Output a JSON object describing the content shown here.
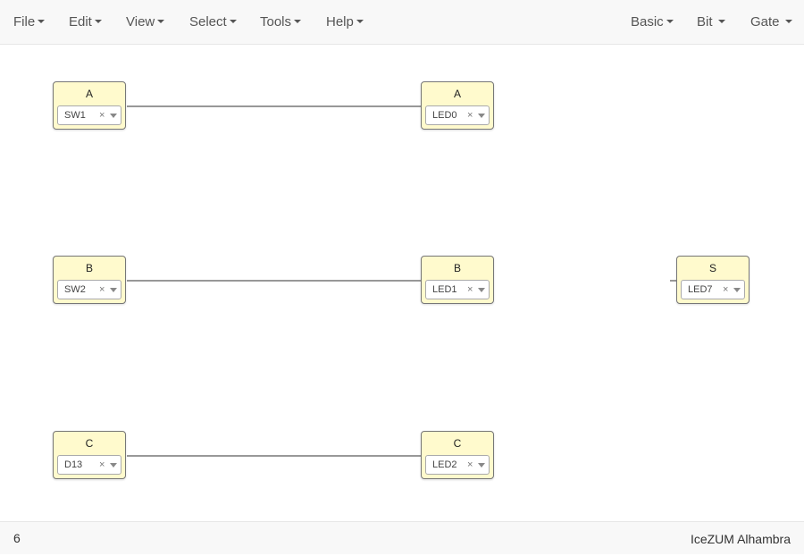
{
  "menus_left": [
    "File",
    "Edit",
    "View",
    "Select",
    "Tools",
    "Help"
  ],
  "menus_right": [
    "Basic",
    "Bit",
    "Gate"
  ],
  "blocks": {
    "in_a": {
      "label": "A",
      "pin": "SW1"
    },
    "in_b": {
      "label": "B",
      "pin": "SW2"
    },
    "in_c": {
      "label": "C",
      "pin": "D13"
    },
    "out_a": {
      "label": "A",
      "pin": "LED0"
    },
    "out_b": {
      "label": "B",
      "pin": "LED1"
    },
    "out_c": {
      "label": "C",
      "pin": "LED2"
    },
    "out_s": {
      "label": "S",
      "pin": "LED7"
    }
  },
  "pin_clear_glyph": "×",
  "colors": {
    "block_fill": "#fffacd",
    "block_border": "#777777",
    "wire": "#777777",
    "menubar_bg": "#f8f8f8"
  },
  "footer": {
    "left": "6",
    "board": "IceZUM Alhambra"
  }
}
